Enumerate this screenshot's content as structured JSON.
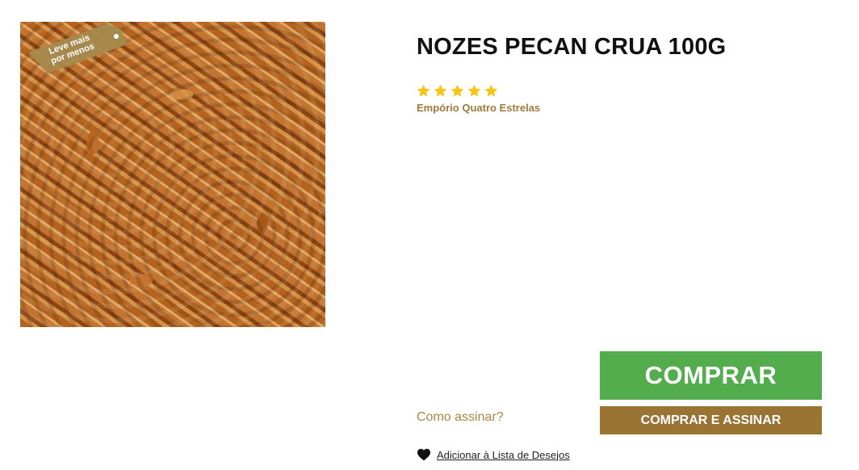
{
  "product": {
    "image_alt": "Nozes pecan",
    "promo_badge": {
      "line1": "Leve mais",
      "line2": "por menos"
    },
    "title": "NOZES PECAN CRUA 100G",
    "rating": {
      "stars": 5,
      "max": 5
    },
    "brand": "Empório Quatro Estrelas"
  },
  "actions": {
    "how_to_subscribe": "Como assinar?",
    "buy_label": "COMPRAR",
    "buy_subscribe_label": "COMPRAR E ASSINAR",
    "wishlist_label": "Adicionar à Lista de Desejos"
  },
  "colors": {
    "buy_button": "#53ad4d",
    "subscribe_button": "#9a7433",
    "star": "#f5c518",
    "brand_text": "#a07a3c",
    "badge": "#a58a4e"
  },
  "icons": {
    "rating": "star-icon",
    "wishlist": "heart-icon"
  }
}
